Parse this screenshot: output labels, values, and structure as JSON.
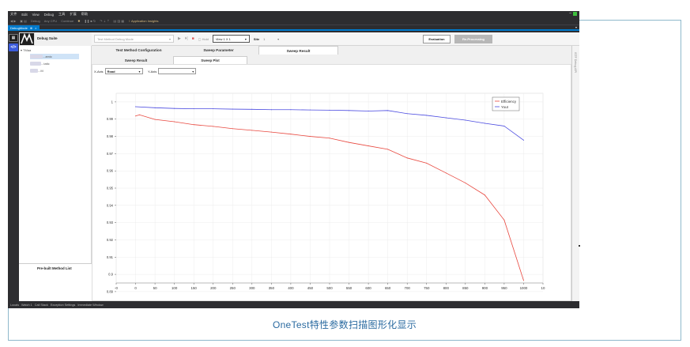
{
  "window": {
    "menu": [
      "文件",
      "Edit",
      "View",
      "Debug",
      "工具",
      "扩展",
      "帮助"
    ],
    "toolbar_items": [
      "Debug",
      "Any CPU",
      "Continue",
      "Application Insights"
    ],
    "doc_tab": "DebugMode",
    "doc_tab_close": "×"
  },
  "app": {
    "suite_title": "Debug Suite",
    "mode_select": "Test Method Debug Mode",
    "hold_label": "Hold",
    "view_select": "View 1 X 1",
    "site_label": "Site",
    "site_value": "1",
    "evaluation_button": "Evaluation",
    "reprocessing_button": "Re-Processing",
    "right_panel_label": "ISTF Debug API"
  },
  "sidebar": {
    "tree_items": [
      "...amic",
      "...tatic",
      "...M"
    ],
    "prebuilt_title": "Pre-built Method List"
  },
  "tabs": {
    "top": [
      "Test Method Configuration",
      "Sweep Parameter",
      "Sweep Result"
    ],
    "top_active": 2,
    "sub": [
      "Sweep Result",
      "Sweep Plot"
    ],
    "sub_active": 1
  },
  "axis_controls": {
    "x_label": "X-Axis",
    "x_value": "Road",
    "y_label": "Y-Axis",
    "y_value": ""
  },
  "chart_data": {
    "type": "line",
    "xlim": [
      -50,
      1050
    ],
    "ylim": [
      0.895,
      1.005
    ],
    "x_ticks": [
      -50,
      0,
      50,
      100,
      150,
      200,
      250,
      300,
      350,
      400,
      450,
      500,
      550,
      600,
      650,
      700,
      750,
      800,
      850,
      900,
      950,
      1000,
      1050
    ],
    "x_tick_labels": [
      "-0",
      "0",
      "50",
      "100",
      "150",
      "200",
      "250",
      "300",
      "350",
      "400",
      "450",
      "500",
      "550",
      "600",
      "650",
      "700",
      "750",
      "800",
      "850",
      "900",
      "950",
      "1000",
      "10"
    ],
    "y_ticks": [
      1.0,
      0.99,
      0.98,
      0.97,
      0.96,
      0.95,
      0.94,
      0.93,
      0.92,
      0.91,
      0.9,
      0.89
    ],
    "y_tick_labels": [
      "1",
      "0.99",
      "0.98",
      "0.97",
      "0.96",
      "0.95",
      "0.94",
      "0.93",
      "0.92",
      "0.91",
      "0.9",
      "0.89"
    ],
    "grid": true,
    "legend_position": "top-right",
    "series": [
      {
        "name": "Efficiency",
        "color": "#e8483f",
        "x": [
          0,
          10,
          50,
          100,
          150,
          200,
          250,
          300,
          350,
          400,
          450,
          500,
          550,
          600,
          650,
          700,
          750,
          800,
          850,
          900,
          950,
          1000
        ],
        "y": [
          0.9918,
          0.9925,
          0.9898,
          0.9885,
          0.9868,
          0.9858,
          0.9845,
          0.9835,
          0.9825,
          0.9813,
          0.98,
          0.979,
          0.9765,
          0.9745,
          0.9725,
          0.9675,
          0.9645,
          0.9588,
          0.953,
          0.946,
          0.9315,
          0.8965
        ]
      },
      {
        "name": "Yout",
        "color": "#4a4ae0",
        "x": [
          0,
          50,
          100,
          150,
          200,
          250,
          300,
          350,
          400,
          450,
          500,
          550,
          600,
          650,
          700,
          750,
          800,
          850,
          900,
          950,
          1000
        ],
        "y": [
          0.9972,
          0.9966,
          0.9962,
          0.996,
          0.996,
          0.9958,
          0.9957,
          0.9955,
          0.9955,
          0.9953,
          0.9952,
          0.995,
          0.9947,
          0.995,
          0.9932,
          0.9922,
          0.9908,
          0.9894,
          0.9876,
          0.986,
          0.9778
        ]
      }
    ]
  },
  "status_items": [
    "Locals",
    "Watch 1",
    "Call Stack",
    "Exception Settings",
    "Immediate Window"
  ],
  "caption": "OneTest特性参数扫描图形化显示"
}
